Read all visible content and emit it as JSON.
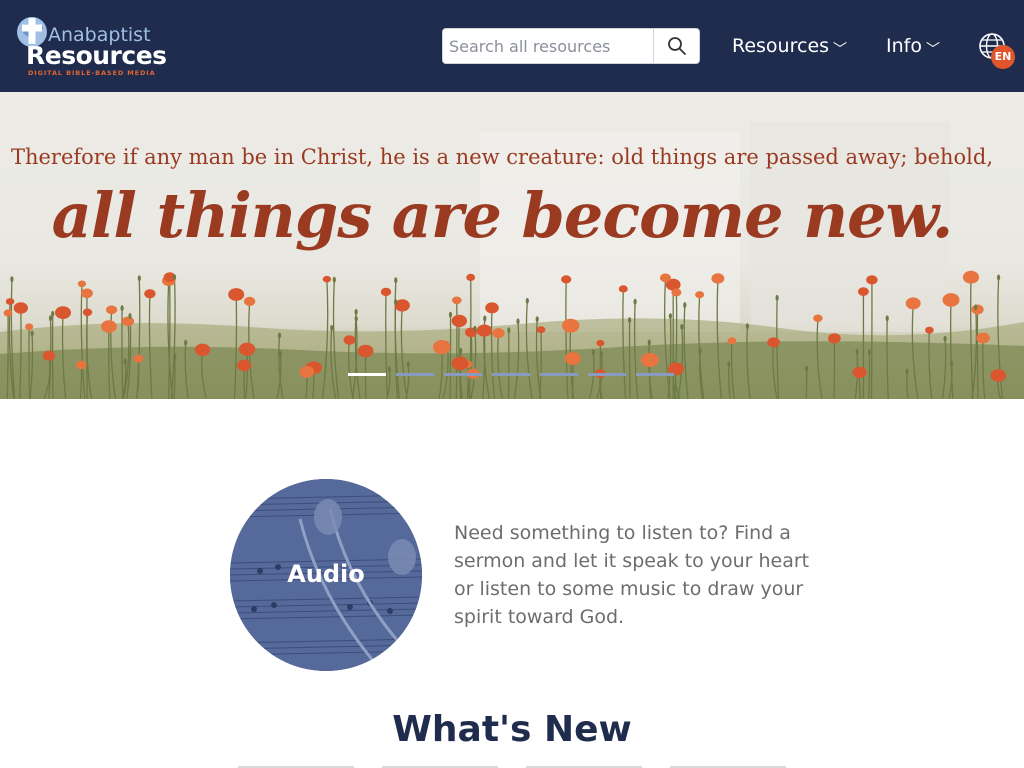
{
  "header": {
    "logo": {
      "top": "Anabaptist",
      "main": "Resources",
      "tagline": "DIGITAL BIBLE-BASED MEDIA"
    },
    "search": {
      "placeholder": "Search all resources",
      "value": "",
      "button_icon": "search-icon"
    },
    "nav": {
      "resources_label": "Resources",
      "info_label": "Info",
      "chevron_icon": "chevron-down-icon"
    },
    "language": {
      "icon": "globe-icon",
      "code": "EN"
    }
  },
  "hero": {
    "line1": "Therefore if any man be in Christ, he is a new creature: old things are passed away; behold,",
    "line2": "all things are become new.",
    "slide_count": 7,
    "active_slide": 1
  },
  "feature": {
    "title": "Audio",
    "description": "Need something to listen to? Find a sermon and let it speak to your heart or listen to some music to draw your spirit toward God."
  },
  "whats_new": {
    "heading": "What's New"
  },
  "colors": {
    "header_bg": "#1f2c4d",
    "accent": "#e0552a",
    "verse": "#9a3a21",
    "feature_overlay": "#4b5f8f",
    "heading": "#1f2c4d"
  }
}
